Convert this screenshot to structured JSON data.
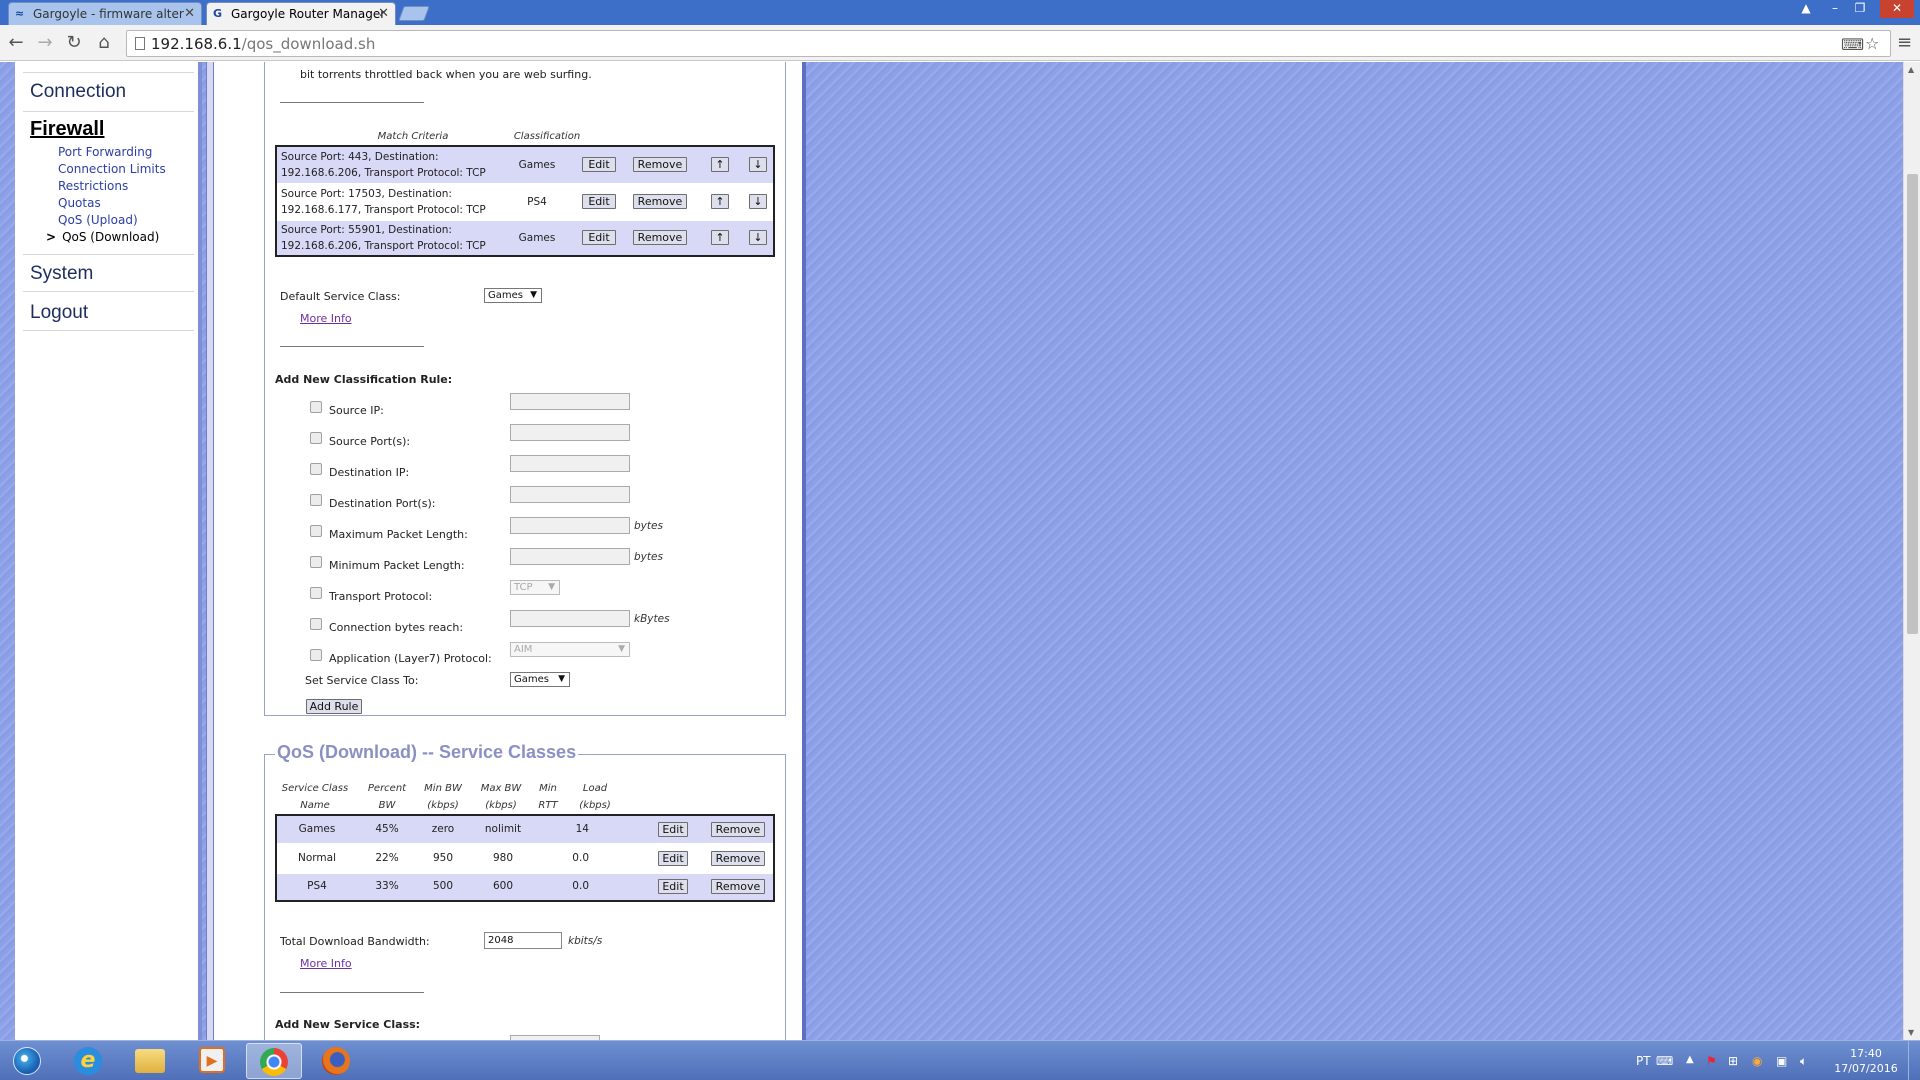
{
  "browser": {
    "tabs": [
      {
        "title": "Gargoyle - firmware alter"
      },
      {
        "title": "Gargoyle Router Manager"
      }
    ],
    "url_host": "192.168.6.1",
    "url_path": "/qos_download.sh"
  },
  "nav": {
    "sections": [
      "Connection",
      "Firewall",
      "System",
      "Logout"
    ],
    "firewall_items": [
      "Port Forwarding",
      "Connection Limits",
      "Restrictions",
      "Quotas",
      "QoS (Upload)",
      "QoS (Download)"
    ],
    "current_marker": ">"
  },
  "rules": {
    "intro_text": "bit torrents throttled back when you are web surfing.",
    "headers": {
      "match": "Match Criteria",
      "classification": "Classification"
    },
    "rows": [
      {
        "line1": "Source Port: 443, Destination:",
        "line2": "192.168.6.206, Transport Protocol: TCP",
        "classification": "Games"
      },
      {
        "line1": "Source Port: 17503, Destination:",
        "line2": "192.168.6.177, Transport Protocol: TCP",
        "classification": "PS4"
      },
      {
        "line1": "Source Port: 55901, Destination:",
        "line2": "192.168.6.206, Transport Protocol: TCP",
        "classification": "Games"
      }
    ],
    "edit_label": "Edit",
    "remove_label": "Remove",
    "up_label": "↑",
    "down_label": "↓",
    "default_class_label": "Default Service Class:",
    "default_class_value": "Games",
    "more_info": "More Info"
  },
  "add_rule": {
    "title": "Add New Classification Rule:",
    "fields": [
      {
        "label": "Source IP:"
      },
      {
        "label": "Source Port(s):"
      },
      {
        "label": "Destination IP:"
      },
      {
        "label": "Destination Port(s):"
      },
      {
        "label": "Maximum Packet Length:",
        "unit": "bytes"
      },
      {
        "label": "Minimum Packet Length:",
        "unit": "bytes"
      },
      {
        "label": "Transport Protocol:",
        "select": "TCP"
      },
      {
        "label": "Connection bytes reach:",
        "unit": "kBytes"
      },
      {
        "label": "Application (Layer7) Protocol:",
        "select": "AIM"
      }
    ],
    "set_class_label": "Set Service Class To:",
    "set_class_value": "Games",
    "add_button": "Add Rule"
  },
  "classes": {
    "legend": "QoS (Download) -- Service Classes",
    "headers": {
      "name1": "Service Class",
      "name2": "Name",
      "pct1": "Percent",
      "pct2": "BW",
      "min1": "Min BW",
      "min2": "(kbps)",
      "max1": "Max BW",
      "max2": "(kbps)",
      "rtt1": "Min",
      "rtt2": "RTT",
      "load1": "Load",
      "load2": "(kbps)"
    },
    "rows": [
      {
        "name": "Games",
        "percent": "45%",
        "min": "zero",
        "max": "nolimit",
        "load": "14"
      },
      {
        "name": "Normal",
        "percent": "22%",
        "min": "950",
        "max": "980",
        "load": "0.0"
      },
      {
        "name": "PS4",
        "percent": "33%",
        "min": "500",
        "max": "600",
        "load": "0.0"
      }
    ],
    "edit_label": "Edit",
    "remove_label": "Remove",
    "total_label": "Total Download Bandwidth:",
    "total_value": "2048",
    "total_unit": "kbits/s",
    "more_info": "More Info",
    "add_class_title": "Add New Service Class:"
  },
  "tray": {
    "lang": "PT",
    "time": "17:40",
    "date": "17/07/2016"
  },
  "colors": {
    "page_bg": "#8ea0e8",
    "row_odd": "#d8d9f7",
    "legend": "#8a90c4",
    "nav_link": "#2d3ea6",
    "taskbar": "#5a7ac0"
  }
}
